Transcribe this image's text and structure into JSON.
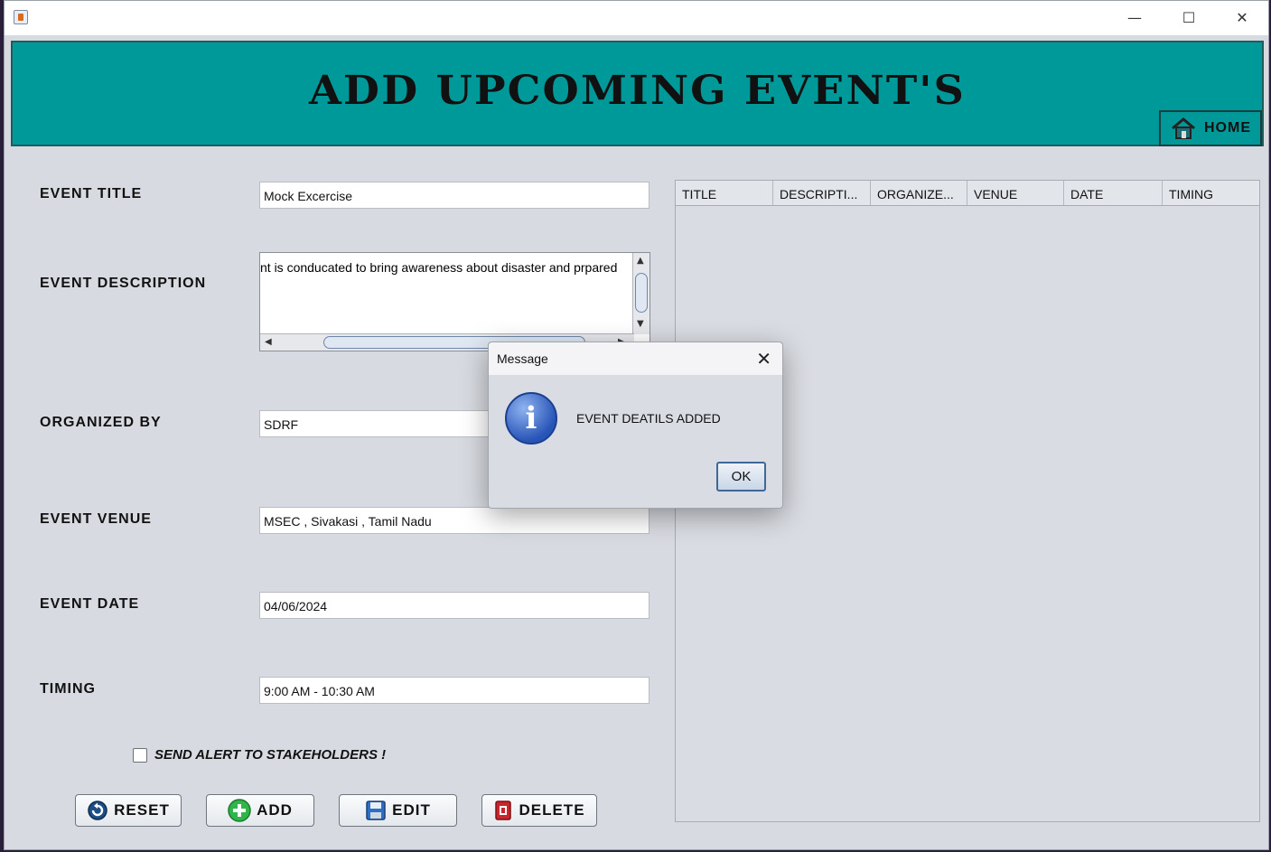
{
  "window": {
    "controls": {
      "minimize": "—",
      "maximize": "☐",
      "close": "✕"
    }
  },
  "header": {
    "title": "ADD UPCOMING EVENT'S",
    "home_label": "HOME"
  },
  "form": {
    "event_title_label": "EVENT TITLE",
    "event_title_value": "Mock Excercise",
    "event_description_label": "EVENT DESCRIPTION",
    "event_description_value": "nt is conducated to bring awareness about disaster and prpared",
    "organized_by_label": "ORGANIZED BY",
    "organized_by_value": "SDRF",
    "event_venue_label": "EVENT VENUE",
    "event_venue_value": "MSEC , Sivakasi , Tamil Nadu",
    "event_date_label": "EVENT DATE",
    "event_date_value": "04/06/2024",
    "timing_label": "TIMING",
    "timing_value": "9:00 AM - 10:30 AM",
    "send_alert_label": "SEND ALERT TO STAKEHOLDERS !",
    "send_alert_checked": false
  },
  "buttons": {
    "reset": "RESET",
    "add": "ADD",
    "edit": "EDIT",
    "delete": "DELETE"
  },
  "table": {
    "columns": [
      "TITLE",
      "DESCRIPTI...",
      "ORGANIZE...",
      "VENUE",
      "DATE",
      "TIMING"
    ],
    "rows": []
  },
  "dialog": {
    "title": "Message",
    "close": "✕",
    "message": "EVENT DEATILS ADDED",
    "ok_label": "OK"
  },
  "colors": {
    "banner": "#00999a",
    "window_bg": "#d7dae0",
    "info_icon": "#2754b7"
  }
}
